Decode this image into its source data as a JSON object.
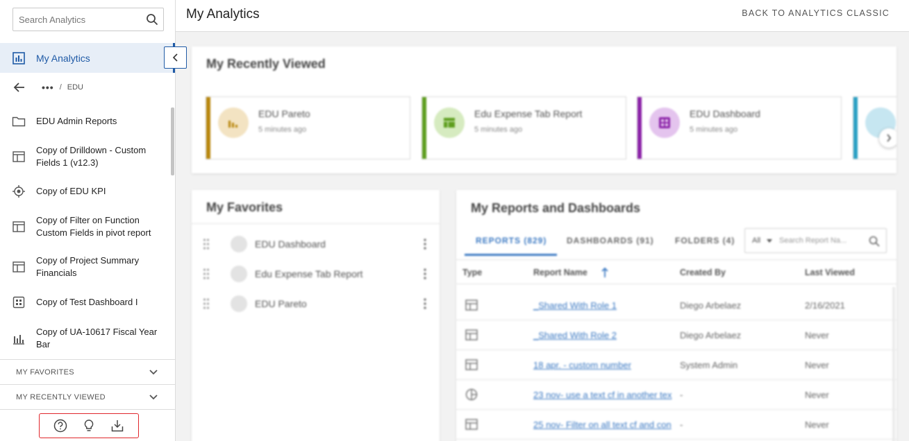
{
  "sidebar": {
    "search_placeholder": "Search Analytics",
    "my_analytics_label": "My Analytics",
    "breadcrumb": {
      "ellipsis": "•••",
      "separator": "/",
      "current": "EDU"
    },
    "items": [
      {
        "label": "EDU Admin Reports",
        "icon": "folder-icon"
      },
      {
        "label": "Copy of Drilldown - Custom Fields 1 (v12.3)",
        "icon": "table-report-icon"
      },
      {
        "label": "Copy of EDU KPI",
        "icon": "kpi-target-icon"
      },
      {
        "label": "Copy of Filter on Function Custom Fields in pivot report",
        "icon": "table-report-icon"
      },
      {
        "label": "Copy of Project Summary Financials",
        "icon": "table-report-icon"
      },
      {
        "label": "Copy of Test Dashboard I",
        "icon": "dashboard-icon"
      },
      {
        "label": "Copy of UA-10617 Fiscal Year Bar",
        "icon": "bar-chart-icon"
      }
    ],
    "sections": [
      {
        "label": "MY FAVORITES"
      },
      {
        "label": "MY RECENTLY VIEWED"
      }
    ]
  },
  "header": {
    "title": "My Analytics",
    "classic_link": "BACK TO ANALYTICS CLASSIC"
  },
  "recent": {
    "title": "My Recently Viewed",
    "tiles": [
      {
        "name": "EDU Pareto",
        "time": "5 minutes ago",
        "color": "#b8860b",
        "circle": "#f3e3c2"
      },
      {
        "name": "Edu Expense Tab Report",
        "time": "5 minutes ago",
        "color": "#5e9e1f",
        "circle": "#d6ebc0"
      },
      {
        "name": "EDU Dashboard",
        "time": "5 minutes ago",
        "color": "#8b22a8",
        "circle": "#e4c4ee"
      }
    ]
  },
  "favorites": {
    "title": "My Favorites",
    "items": [
      {
        "name": "EDU Dashboard"
      },
      {
        "name": "Edu Expense Tab Report"
      },
      {
        "name": "EDU Pareto"
      }
    ]
  },
  "reports": {
    "title": "My Reports and Dashboards",
    "tabs": [
      {
        "label": "REPORTS (829)"
      },
      {
        "label": "DASHBOARDS (91)"
      },
      {
        "label": "FOLDERS (4)"
      }
    ],
    "filter_value": "All",
    "search_placeholder": "Search Report Na...",
    "columns": [
      "Type",
      "Report Name",
      "Created By",
      "Last Viewed"
    ],
    "rows": [
      {
        "name": "_Shared With Role 1",
        "created_by": "Diego Arbelaez",
        "last_viewed": "2/16/2021"
      },
      {
        "name": "_Shared With Role 2",
        "created_by": "Diego Arbelaez",
        "last_viewed": "Never"
      },
      {
        "name": "18 apr. - custom number",
        "created_by": "System Admin",
        "last_viewed": "Never"
      },
      {
        "name": "23 nov- use a text cf in another tex",
        "created_by": "-",
        "last_viewed": "Never"
      },
      {
        "name": "25 nov- Filter on all text cf and con",
        "created_by": "-",
        "last_viewed": "Never"
      }
    ]
  }
}
